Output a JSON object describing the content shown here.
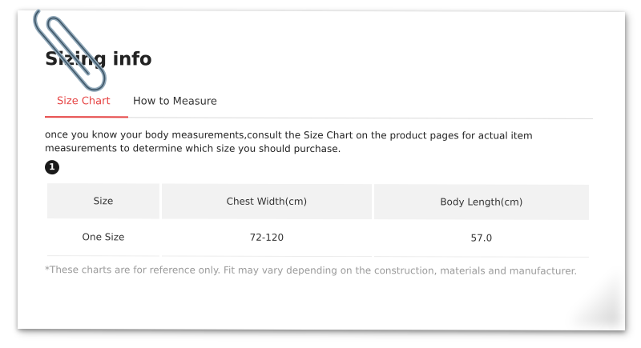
{
  "page": {
    "title": "Sizing info"
  },
  "tabs": [
    {
      "label": "Size Chart",
      "active": true
    },
    {
      "label": "How to Measure",
      "active": false
    }
  ],
  "description": "once you know your body measurements,consult the Size Chart on the product pages for actual item measurements to determine which size you should purchase.",
  "step_badge": "1",
  "table": {
    "headers": [
      "Size",
      "Chest Width(cm)",
      "Body Length(cm)"
    ],
    "rows": [
      [
        "One Size",
        "72-120",
        "57.0"
      ]
    ]
  },
  "note": "*These charts are for reference only. Fit may vary depending on the construction, materials and manufacturer.",
  "colors": {
    "accent": "#e64545",
    "header_bg": "#f2f2f2",
    "muted_text": "#9a9a9a"
  },
  "icons": {
    "clip": "paperclip-icon"
  }
}
